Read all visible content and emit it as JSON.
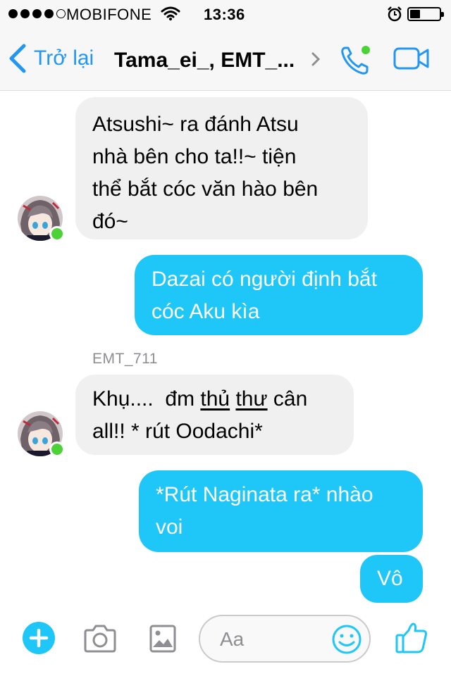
{
  "status_bar": {
    "carrier": "MOBIFONE",
    "time": "13:36",
    "battery_level": 0.35
  },
  "header": {
    "back_label": "Trở lại",
    "title": "Tama_ei_, EMT_..."
  },
  "messages": [
    {
      "direction": "incoming",
      "lines": [
        "Atsushi~ ra đánh Atsu",
        "nhà bên cho ta!!~ tiện",
        "thể bắt cóc văn hào bên",
        "đó~"
      ]
    },
    {
      "direction": "outgoing",
      "lines": [
        "Dazai có người định bắt",
        "cóc Aku kìa"
      ]
    },
    {
      "direction": "incoming",
      "sender": "EMT_711",
      "line1_a": "Khụ....  đm ",
      "line1_u1": "thủ",
      "line1_sp": " ",
      "line1_u2": "thư",
      "line1_b": " cân",
      "line2": "all!! * rút Oodachi*"
    },
    {
      "direction": "outgoing",
      "lines": [
        "*Rút Naginata ra* nhào",
        "voi"
      ]
    },
    {
      "direction": "outgoing",
      "lines": [
        "Vô"
      ]
    }
  ],
  "composer": {
    "placeholder": "Aa"
  },
  "colors": {
    "accent": "#2196f3",
    "outgoing_bubble": "#1ec7f7",
    "incoming_bubble": "#f1f0f0",
    "online": "#4cd137"
  },
  "icons": [
    "signal-icon",
    "wifi-icon",
    "alarm-icon",
    "battery-icon",
    "back-chevron-icon",
    "chevron-right-icon",
    "phone-icon",
    "video-camera-icon",
    "plus-icon",
    "camera-icon",
    "image-icon",
    "smiley-icon",
    "thumbs-up-icon"
  ]
}
